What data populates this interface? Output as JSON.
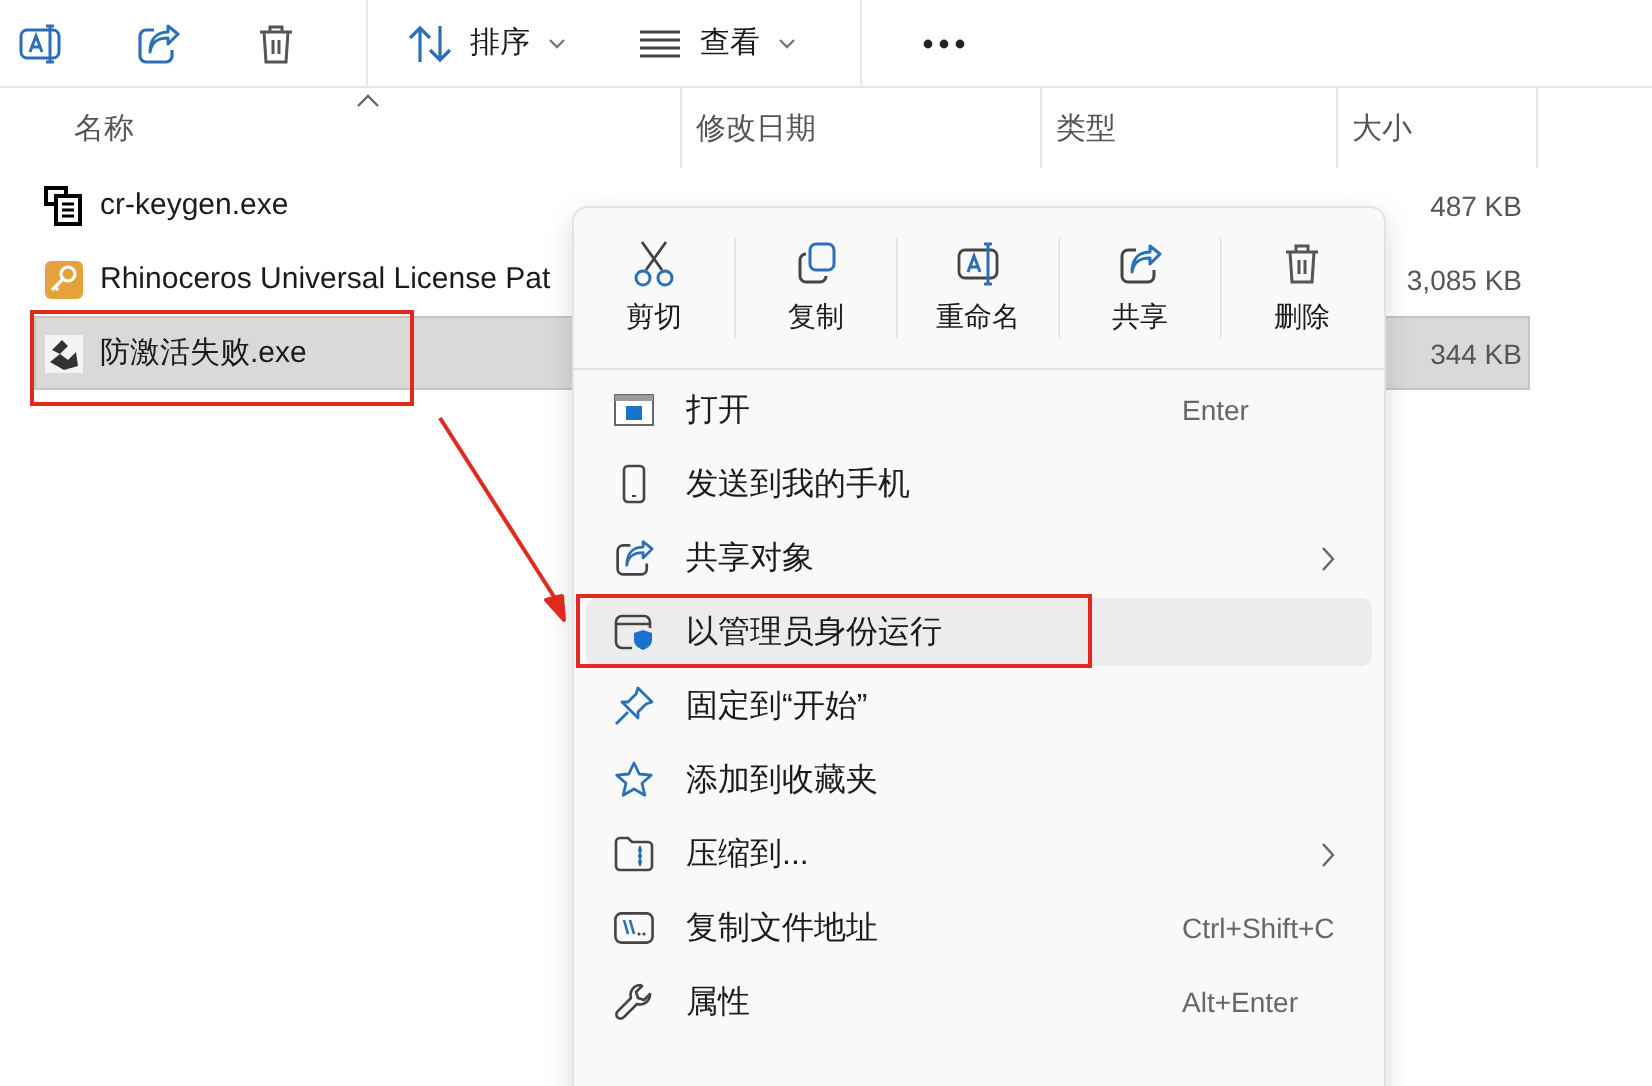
{
  "toolbar": [
    {
      "kind": "rename"
    },
    {
      "kind": "share"
    },
    {
      "kind": "delete"
    },
    {
      "kind": "sort",
      "label": "排序"
    },
    {
      "kind": "view",
      "label": "查看"
    },
    {
      "kind": "more"
    }
  ],
  "columns": [
    {
      "label": "名称",
      "sorted": true
    },
    {
      "label": "修改日期",
      "sorted": false
    },
    {
      "label": "类型",
      "sorted": false
    },
    {
      "label": "大小",
      "sorted": false
    }
  ],
  "files": [
    {
      "name": "cr-keygen.exe",
      "kind": "app",
      "size": "487 KB",
      "selected": false,
      "annotated": false
    },
    {
      "name": "Rhinoceros Universal License Pat",
      "kind": "key",
      "size": "3,085 KB",
      "selected": false,
      "annotated": false
    },
    {
      "name": "防激活失败.exe",
      "kind": "exe",
      "size": "344 KB",
      "selected": true,
      "annotated": true
    }
  ],
  "context_menu": {
    "actions": [
      {
        "kind": "cut",
        "label": "剪切"
      },
      {
        "kind": "copy",
        "label": "复制"
      },
      {
        "kind": "rename",
        "label": "重命名"
      },
      {
        "kind": "share",
        "label": "共享"
      },
      {
        "kind": "delete",
        "label": "删除"
      }
    ],
    "items": [
      {
        "kind": "open",
        "label": "打开",
        "shortcut": "Enter",
        "submenu": false,
        "highlighted": false,
        "annotated": false
      },
      {
        "kind": "phone",
        "label": "发送到我的手机",
        "submenu": false,
        "highlighted": false,
        "annotated": false
      },
      {
        "kind": "share",
        "label": "共享对象",
        "submenu": true,
        "highlighted": false,
        "annotated": false
      },
      {
        "kind": "admin",
        "label": "以管理员身份运行",
        "submenu": false,
        "highlighted": true,
        "annotated": true
      },
      {
        "kind": "pin",
        "label": "固定到“开始”",
        "submenu": false,
        "highlighted": false,
        "annotated": false
      },
      {
        "kind": "star",
        "label": "添加到收藏夹",
        "submenu": false,
        "highlighted": false,
        "annotated": false
      },
      {
        "kind": "zip",
        "label": "压缩到...",
        "submenu": true,
        "highlighted": false,
        "annotated": false
      },
      {
        "kind": "path",
        "label": "复制文件地址",
        "shortcut": "Ctrl+Shift+C",
        "submenu": false,
        "highlighted": false,
        "annotated": false
      },
      {
        "kind": "props",
        "label": "属性",
        "shortcut": "Alt+Enter",
        "submenu": false,
        "highlighted": false,
        "annotated": false
      }
    ]
  }
}
